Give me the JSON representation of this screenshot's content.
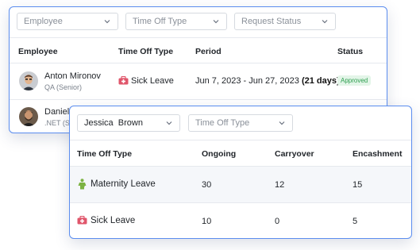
{
  "back_card": {
    "filters": {
      "employee_placeholder": "Employee",
      "time_off_type_placeholder": "Time Off Type",
      "request_status_placeholder": "Request Status"
    },
    "columns": [
      "Employee",
      "Time Off Type",
      "Period",
      "Status"
    ],
    "rows": [
      {
        "name": "Anton Mironov",
        "role": "QA (Senior)",
        "time_off_type": "Sick Leave",
        "period": "Jun 7, 2023 - Jun 27, 2023",
        "days": "(21 days)",
        "status": "Approved",
        "type_icon": "medical-bag-icon"
      },
      {
        "name": "Daniel",
        "role": ".NET (Se",
        "time_off_type": "",
        "period": "",
        "days": "",
        "status": ""
      }
    ]
  },
  "front_card": {
    "filters": {
      "employee_value": "Jessica  Brown",
      "time_off_type_placeholder": "Time Off Type"
    },
    "columns": [
      "Time Off Type",
      "Ongoing",
      "Carryover",
      "Encashment"
    ],
    "rows": [
      {
        "type": "Maternity Leave",
        "ongoing": "30",
        "carryover": "12",
        "encashment": "15",
        "icon": "maternity-icon"
      },
      {
        "type": "Sick Leave",
        "ongoing": "10",
        "carryover": "0",
        "encashment": "5",
        "icon": "medical-bag-icon"
      }
    ]
  },
  "colors": {
    "accent_border": "#5b8def",
    "approved_text": "#2e9e4f",
    "approved_bg": "#e3f5e8",
    "sick_icon": "#e0566b",
    "maternity_icon": "#7cb342"
  }
}
